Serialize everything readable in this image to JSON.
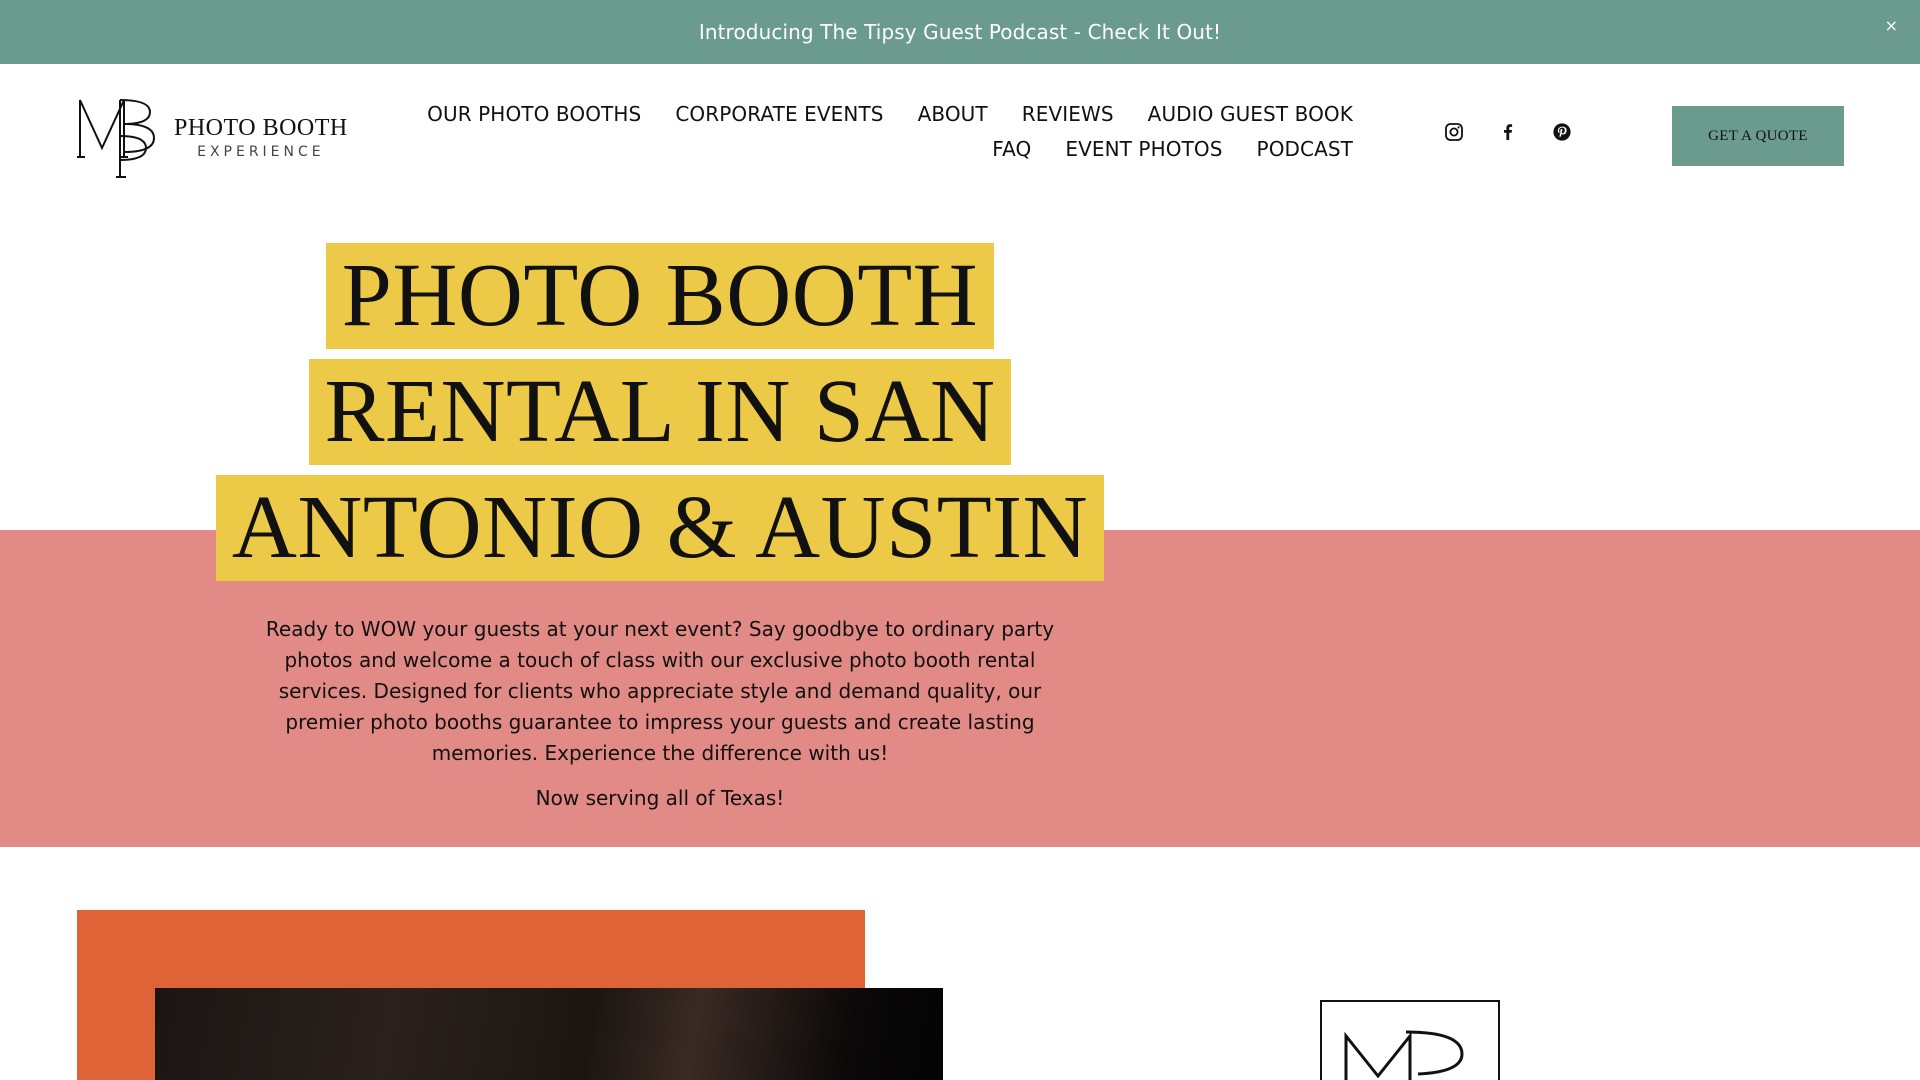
{
  "announcement": {
    "text": "Introducing The Tipsy Guest Podcast - Check It Out!",
    "close_label": "×"
  },
  "logo": {
    "line1": "PHOTO BOOTH",
    "line2": "EXPERIENCE"
  },
  "nav": {
    "row1": [
      {
        "label": "OUR PHOTO BOOTHS"
      },
      {
        "label": "CORPORATE EVENTS"
      },
      {
        "label": "ABOUT"
      },
      {
        "label": "REVIEWS"
      },
      {
        "label": "AUDIO GUEST BOOK"
      }
    ],
    "row2": [
      {
        "label": "FAQ"
      },
      {
        "label": "EVENT PHOTOS"
      },
      {
        "label": "PODCAST"
      }
    ]
  },
  "social": {
    "icons": [
      "instagram-icon",
      "facebook-icon",
      "pinterest-icon"
    ]
  },
  "cta": {
    "label": "GET A QUOTE"
  },
  "hero": {
    "title_lines": [
      "PHOTO BOOTH",
      "RENTAL IN SAN",
      "ANTONIO & AUSTIN"
    ],
    "paragraph": "Ready to WOW your guests at your next event? Say goodbye to ordinary party photos and welcome a touch of class with our exclusive photo booth rental services. Designed for clients who appreciate style and demand quality, our premier photo booths guarantee to impress your guests and create lasting memories. Experience the difference with us!",
    "serving": "Now serving all of Texas!"
  },
  "colors": {
    "accent_green": "#6a9b8c",
    "highlight_yellow": "#ecc947",
    "band_pink": "#e28a85",
    "block_orange": "#de6438",
    "text": "#111111"
  }
}
